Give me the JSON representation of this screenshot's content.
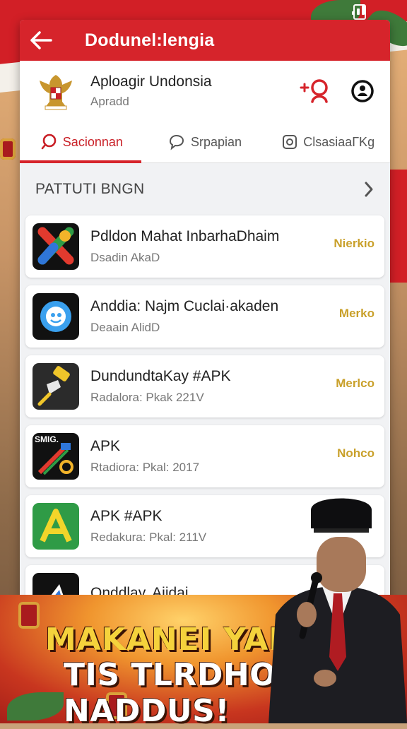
{
  "colors": {
    "brand_red": "#d6242b",
    "action_gold": "#c9a02a",
    "banner_yellow": "#f5d23c"
  },
  "topbar": {
    "title": "Dodunel:lengia",
    "back_icon": "arrow-left-icon"
  },
  "header": {
    "title": "Aploagir Undonsia",
    "subtitle": "Apradd",
    "add_icon": "add-user-icon",
    "settings_icon": "settings-icon"
  },
  "tabs": [
    {
      "label": "Sacionnan",
      "icon": "search-icon",
      "active": true
    },
    {
      "label": "Srpapian",
      "icon": "chat-icon",
      "active": false
    },
    {
      "label": "ClsasiaaГKg",
      "icon": "instagram-icon",
      "active": false
    }
  ],
  "section": {
    "title": "PATTUTI BNGN",
    "chevron_icon": "chevron-right-icon"
  },
  "apps": [
    {
      "name": "Pdldon Mahat InbarhaDhaim",
      "sub": "Dsadin AkaD",
      "action": "Nierkio"
    },
    {
      "name": "Anddia: Najm Cuclai·akaden",
      "sub": "Deaain AlidD",
      "action": "Merko"
    },
    {
      "name": "DundundtaKay #APK",
      "sub": "Radalora: Pkak 221V",
      "action": "Merlco"
    },
    {
      "name": "APK",
      "sub": "Rtadiora: Pkal: 2017",
      "action": "Nohco"
    },
    {
      "name": "APK #APK",
      "sub": "Redakura: Pkal: 211V",
      "action": ""
    },
    {
      "name": "Qnddlay. Aiidai",
      "sub": "",
      "action": ""
    }
  ],
  "app4_icon_text": "SMIG.",
  "banner": {
    "line1": "MAKANEI YADNIR",
    "line2": "TIS TLRDHOAK NADDUS!"
  }
}
